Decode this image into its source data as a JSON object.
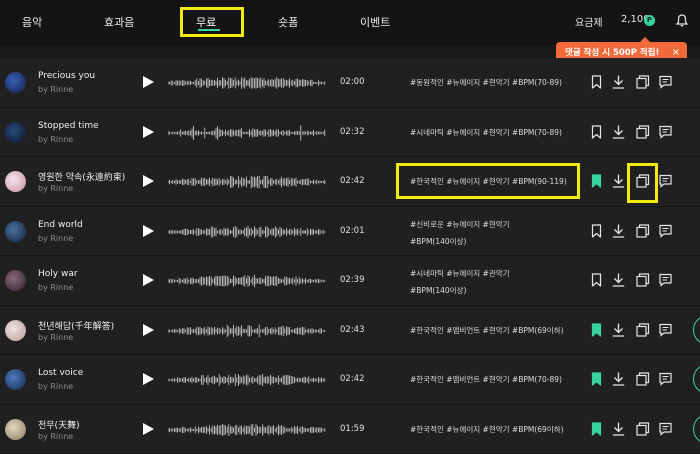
{
  "nav": {
    "items": [
      "음악",
      "효과음",
      "무료",
      "숏폼",
      "이벤트"
    ],
    "active": "무료",
    "pricing_label": "요금제",
    "points": "2,100",
    "points_badge": "P"
  },
  "toast": {
    "text": "댓글 작성 시 500P 적립!",
    "close": "×"
  },
  "colors": {
    "accent": "#38d39f",
    "highlight": "#f2ea12",
    "toast": "#f26a3a",
    "row_bg": "#202020"
  },
  "tracks": [
    {
      "title": "Precious you",
      "artist": "by Rinne",
      "duration": "02:00",
      "tags": [
        "#동원적인 #뉴에이지 #현악기 #BPM(70-89)"
      ],
      "bookmarked": false,
      "thumb": [
        "#3a5fb5",
        "#0f1f45"
      ]
    },
    {
      "title": "Stopped time",
      "artist": "by Rinne",
      "duration": "02:32",
      "tags": [
        "#시네마틱 #뉴에이지 #현악기 #BPM(70-89)"
      ],
      "bookmarked": false,
      "thumb": [
        "#2a4a7a",
        "#0a1428"
      ]
    },
    {
      "title": "영원한 약속(永遠約束)",
      "artist": "by Rinne",
      "duration": "02:42",
      "tags": [
        "#한국적인 #뉴에이지 #현악기 #BPM(90-119)"
      ],
      "bookmarked": true,
      "thumb": [
        "#f4e6ee",
        "#c98aa0"
      ]
    },
    {
      "title": "End world",
      "artist": "by Rinne",
      "duration": "02:01",
      "tags": [
        "#신비로운 #뉴에이지 #현악기",
        "#BPM(140이상)"
      ],
      "bookmarked": false,
      "thumb": [
        "#4a6f9f",
        "#142238"
      ]
    },
    {
      "title": "Holy war",
      "artist": "by Rinne",
      "duration": "02:39",
      "tags": [
        "#시네마틱 #뉴에이지 #관악기",
        "#BPM(140이상)"
      ],
      "bookmarked": false,
      "thumb": [
        "#8a6a7a",
        "#2a1f2f"
      ]
    },
    {
      "title": "천년해답(千年解答)",
      "artist": "by Rinne",
      "duration": "02:43",
      "tags": [
        "#한국적인 #앰비언트 #현악기 #BPM(69이하)"
      ],
      "bookmarked": true,
      "thumb": [
        "#efe2e2",
        "#b89a9a"
      ]
    },
    {
      "title": "Lost voice",
      "artist": "by Rinne",
      "duration": "02:42",
      "tags": [
        "#한국적인 #앰비언트 #현악기 #BPM(70-89)"
      ],
      "bookmarked": true,
      "thumb": [
        "#4d7ac0",
        "#14264a"
      ]
    },
    {
      "title": "천무(天舞)",
      "artist": "by Rinne",
      "duration": "01:59",
      "tags": [
        "#한국적인 #뉴에이지 #현악기 #BPM(69이하)"
      ],
      "bookmarked": true,
      "thumb": [
        "#e0d8c0",
        "#8a7a5a"
      ]
    }
  ]
}
